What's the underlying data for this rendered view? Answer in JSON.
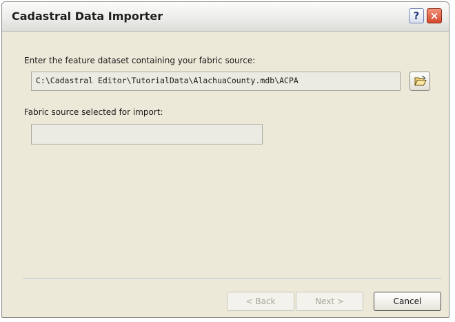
{
  "window": {
    "title": "Cadastral Data Importer",
    "help_glyph": "?",
    "close_glyph": "×"
  },
  "source": {
    "prompt": "Enter the feature dataset containing your fabric source:",
    "path_value": "C:\\Cadastral Editor\\TutorialData\\AlachuaCounty.mdb\\ACPA",
    "browse_icon": "open-folder-icon"
  },
  "selected": {
    "label": "Fabric source selected for import:",
    "value": ""
  },
  "buttons": {
    "back_label": "< Back",
    "next_label": "Next >",
    "cancel_label": "Cancel"
  }
}
